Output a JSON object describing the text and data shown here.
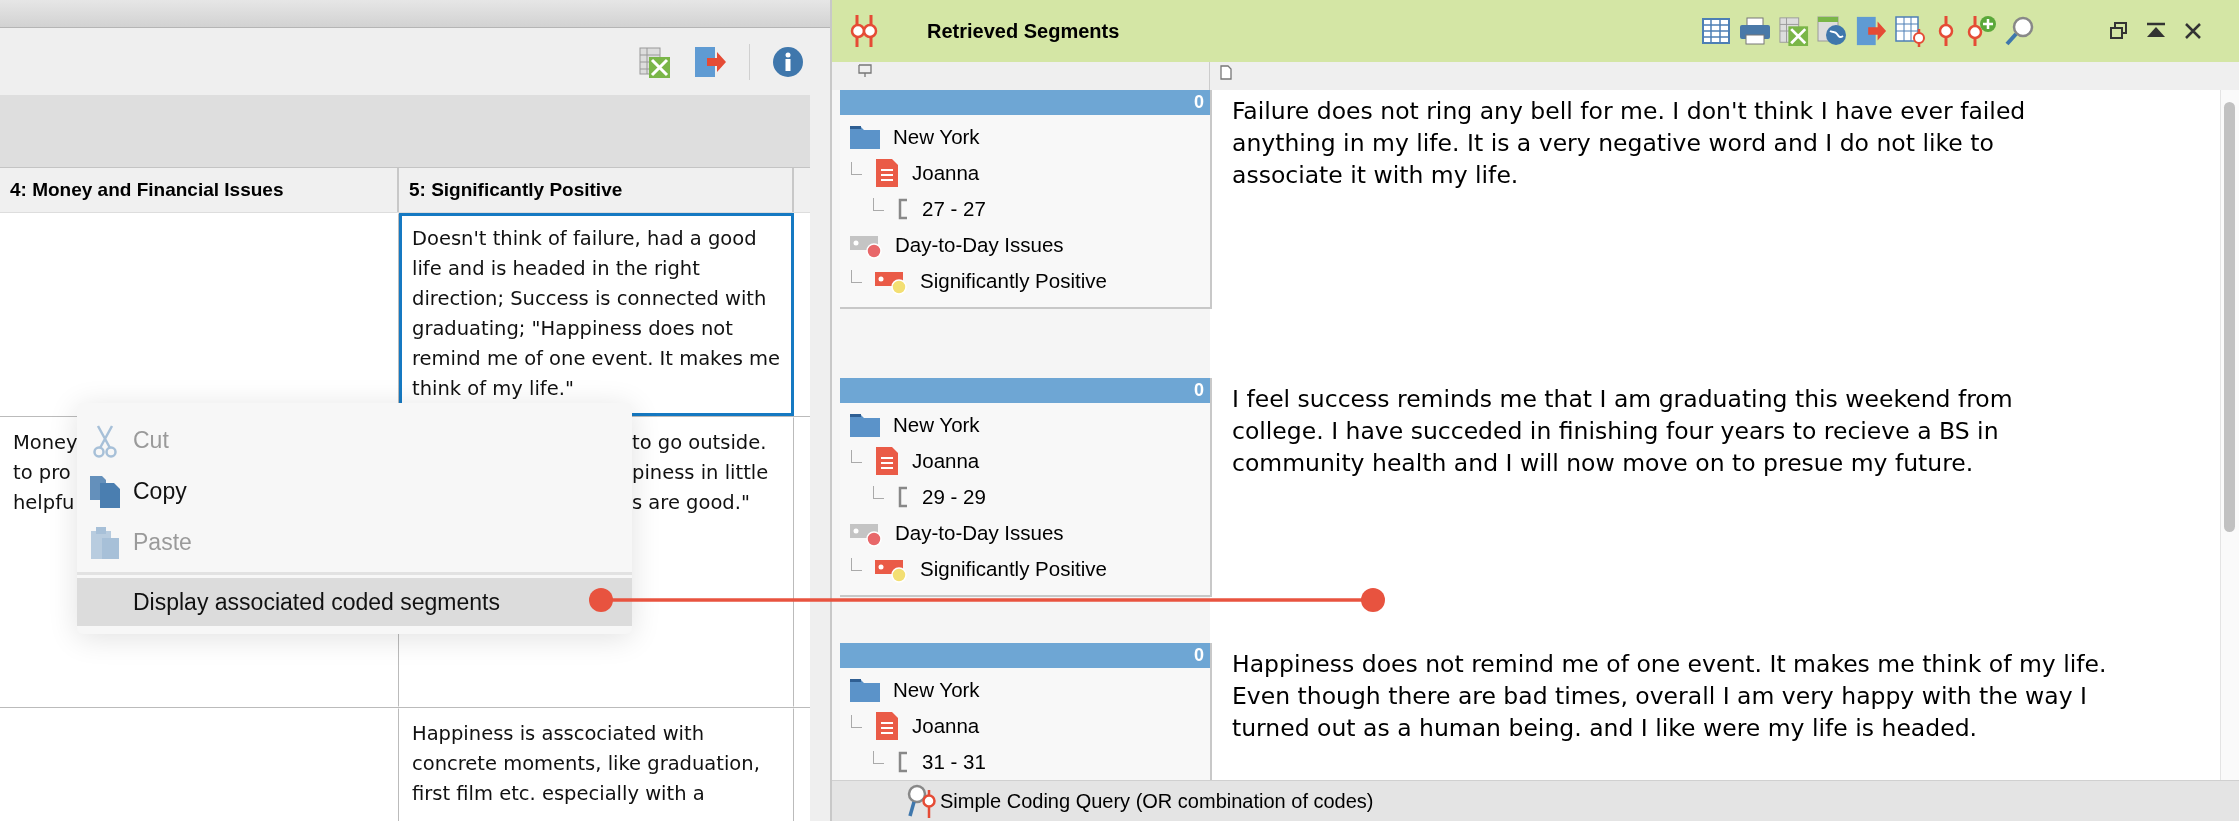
{
  "left_panel": {
    "table": {
      "columns": [
        "4: Money and Financial Issues",
        "5: Significantly Positive"
      ],
      "rows": [
        {
          "cells": [
            {
              "kind": "full",
              "selected": false
            },
            {
              "kind": "full",
              "text": "Doesn't think of failure, had a good life and is headed in the right direction; Success is connected with graduating; \"Happiness does not remind me of one event. It makes me think of my life.\"",
              "selected": true
            }
          ]
        },
        {
          "cells": [
            {
              "kind": "leading",
              "text": "Money\nto pro\nhelpfu",
              "selected": false
            },
            {
              "kind": "trailing",
              "text": "to go outside.\npiness in little\ns are good.\"",
              "selected": false
            }
          ]
        },
        {
          "cells": [
            {
              "kind": "full",
              "selected": false
            },
            {
              "kind": "full",
              "text": "Happiness is asscociated with concrete moments, like graduation, first film etc. especially with a",
              "selected": false
            }
          ]
        }
      ]
    }
  },
  "context_menu": {
    "items": [
      {
        "label": "Cut",
        "kind": "cut",
        "disabled": true,
        "selected": false
      },
      {
        "label": "Copy",
        "kind": "copy",
        "disabled": false,
        "selected": false
      },
      {
        "label": "Paste",
        "kind": "paste",
        "disabled": true,
        "selected": false
      },
      {
        "label": "Display associated coded segments",
        "kind": "plain",
        "disabled": false,
        "selected": true
      }
    ]
  },
  "right_panel": {
    "title": "Retrieved Segments",
    "segments": [
      {
        "count": "0",
        "text": "Failure does not ring any bell for me.  I don't think I have ever failed anything in my life.  It is a very negative word and I do not like to associate it with my life.",
        "tree": [
          {
            "name": "New York",
            "kind": "folder",
            "children": [
              {
                "name": "Joanna",
                "kind": "document",
                "children": [
                  {
                    "name": "27 - 27",
                    "kind": "position"
                  }
                ]
              }
            ]
          },
          {
            "name": "Day-to-Day Issues",
            "kind": "code",
            "color": "#e8686a",
            "children": [
              {
                "name": "Significantly Positive",
                "kind": "code",
                "color": "#f3df73"
              }
            ]
          }
        ]
      },
      {
        "count": "0",
        "text": "I feel success reminds me that I am graduating this weekend from college.  I have succeded in finishing four years to recieve a BS in community health and I will now move on to presue my future.",
        "tree": [
          {
            "name": "New York",
            "kind": "folder",
            "children": [
              {
                "name": "Joanna",
                "kind": "document",
                "children": [
                  {
                    "name": "29 - 29",
                    "kind": "position"
                  }
                ]
              }
            ]
          },
          {
            "name": "Day-to-Day Issues",
            "kind": "code",
            "color": "#e8686a",
            "children": [
              {
                "name": "Significantly Positive",
                "kind": "code",
                "color": "#f3df73"
              }
            ]
          }
        ]
      },
      {
        "count": "0",
        "text": "Happiness does not remind me of one event. It makes me think of my life. Even though there are bad times, overall I am very happy with the way I turned out as a human being. and I like were my life is headed.",
        "tree": [
          {
            "name": "New York",
            "kind": "folder",
            "children": [
              {
                "name": "Joanna",
                "kind": "document",
                "children": [
                  {
                    "name": "31 - 31",
                    "kind": "position"
                  }
                ]
              }
            ]
          }
        ]
      }
    ],
    "status_bar": "Simple Coding Query (OR combination of codes)"
  }
}
